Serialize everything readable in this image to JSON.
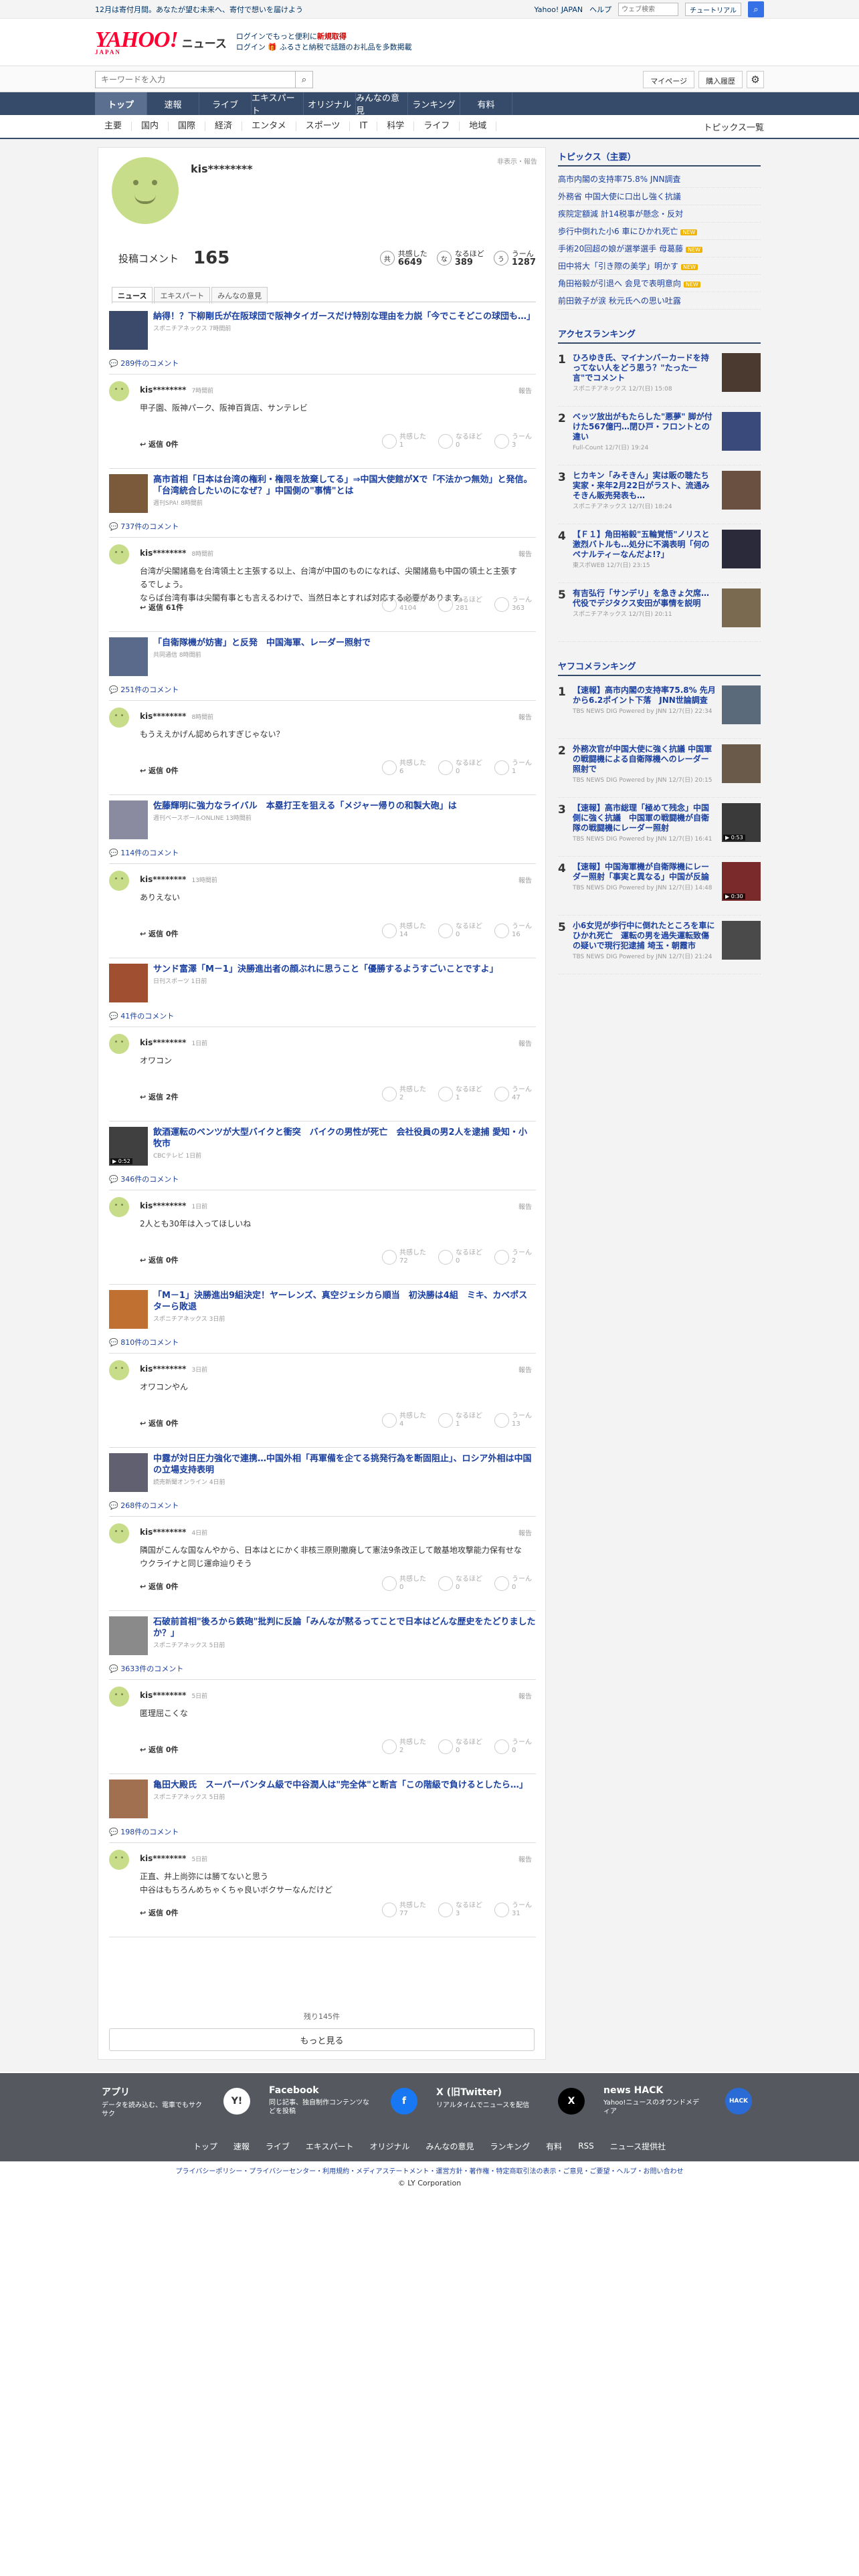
{
  "topbar": {
    "promo": "12月は寄付月間。あなたが望む未来へ、寄付で想いを届けよう",
    "links": [
      "Yahoo! JAPAN",
      "ヘルプ"
    ],
    "search_placeholder": "ウェブ検索",
    "tutorial": "チュートリアル"
  },
  "header": {
    "logo": "YAHOO!",
    "logo_sub": "JAPAN",
    "name": "ニュース",
    "promo1a": "ログインでもっと便利に",
    "promo1b": "新規取得",
    "promo2": "ログイン 🎁 ふるさと納税で話題のお礼品を多数掲載"
  },
  "search": {
    "placeholder": "キーワードを入力",
    "mypage": "マイページ",
    "history": "購入履歴"
  },
  "nav": [
    "トップ",
    "速報",
    "ライブ",
    "エキスパート",
    "オリジナル",
    "みんなの意見",
    "ランキング",
    "有料"
  ],
  "subnav": [
    "主要",
    "国内",
    "国際",
    "経済",
    "エンタメ",
    "スポーツ",
    "IT",
    "科学",
    "ライフ",
    "地域"
  ],
  "subnav_all": "トピックス一覧",
  "profile": {
    "name": "kis********",
    "hide": "非表示・報告",
    "post_label": "投稿コメント",
    "post_count": "165",
    "stats": [
      {
        "icon": "共",
        "label": "共感した",
        "value": "6649"
      },
      {
        "icon": "な",
        "label": "なるほど",
        "value": "389"
      },
      {
        "icon": "う",
        "label": "うーん",
        "value": "1287"
      }
    ]
  },
  "tabs": [
    "ニュース",
    "エキスパート",
    "みんなの意見"
  ],
  "entries": [
    {
      "title": "納得！？下柳剛氏が在阪球団で阪神タイガースだけ特別な理由を力説「今でこそどこの球団も…」",
      "src": "スポニチアネックス 7時間前",
      "comments": "289件のコメント",
      "time": "7時間前",
      "text": "甲子園、阪神パーク、阪神百貨店、サンテレビ",
      "reply": "返信 0件",
      "v": [
        "1",
        "0",
        "3"
      ]
    },
    {
      "title": "高市首相「日本は台湾の権利・権限を放棄してる」⇒中国大使館がXで「不法かつ無効」と発信。「台湾統合したいのになぜ？」中国側の\"事情\"とは",
      "src": "週刊SPA! 8時間前",
      "comments": "737件のコメント",
      "time": "8時間前",
      "text": "台湾が尖閣諸島を台湾領土と主張する以上、台湾が中国のものになれば、尖閣諸島も中国の領土と主張するでしょう。\nならば台湾有事は尖閣有事とも言えるわけで、当然日本とすれば対応する必要があります。",
      "reply": "返信 61件",
      "v": [
        "4104",
        "281",
        "363"
      ]
    },
    {
      "title": "「自衛隊機が妨害」と反発　中国海軍、レーダー照射で",
      "src": "共同通信 8時間前",
      "comments": "251件のコメント",
      "time": "8時間前",
      "text": "もうええかげん認められすぎじゃない？",
      "reply": "返信 0件",
      "v": [
        "6",
        "0",
        "1"
      ]
    },
    {
      "title": "佐藤輝明に強力なライバル　本塁打王を狙える「メジャー帰りの和製大砲」は",
      "src": "週刊ベースボールONLINE 13時間前",
      "comments": "114件のコメント",
      "time": "13時間前",
      "text": "ありえない",
      "reply": "返信 0件",
      "v": [
        "14",
        "0",
        "16"
      ]
    },
    {
      "title": "サンド富澤「M－1」決勝進出者の顔ぶれに思うこと「優勝するようすごいことですよ」",
      "src": "日刊スポーツ 1日前",
      "comments": "41件のコメント",
      "time": "1日前",
      "text": "オワコン",
      "reply": "返信 2件",
      "v": [
        "2",
        "1",
        "47"
      ]
    },
    {
      "title": "飲酒運転のベンツが大型バイクと衝突　バイクの男性が死亡　会社役員の男2人を逮捕 愛知・小牧市",
      "src": "CBCテレビ 1日前",
      "comments": "346件のコメント",
      "time": "1日前",
      "text": "2人とも30年は入ってほしいね",
      "reply": "返信 0件",
      "v": [
        "72",
        "0",
        "2"
      ]
    },
    {
      "title": "「M－1」決勝進出9組決定！ヤーレンズ、真空ジェシカら順当　初決勝は4組　ミキ、カベポスターら敗退",
      "src": "スポニチアネックス 3日前",
      "comments": "810件のコメント",
      "time": "3日前",
      "text": "オワコンやん",
      "reply": "返信 0件",
      "v": [
        "4",
        "1",
        "13"
      ]
    },
    {
      "title": "中露が対日圧力強化で連携…中国外相「再軍備を企てる挑発行為を断固阻止」、ロシア外相は中国の立場支持表明",
      "src": "読売新聞オンライン 4日前",
      "comments": "268件のコメント",
      "time": "4日前",
      "text": "隣国がこんな国なんやから、日本はとにかく非核三原則撤廃して憲法9条改正して敵基地攻撃能力保有せなウクライナと同じ運命辿りそう",
      "reply": "返信 0件",
      "v": [
        "0",
        "0",
        "0"
      ]
    },
    {
      "title": "石破前首相\"後ろから鉄砲\"批判に反論「みんなが黙るってことで日本はどんな歴史をたどりましたか？」",
      "src": "スポニチアネックス 5日前",
      "comments": "3633件のコメント",
      "time": "5日前",
      "text": "匿理屈こくな",
      "reply": "返信 0件",
      "v": [
        "2",
        "0",
        "0"
      ]
    },
    {
      "title": "亀田大殿氏　スーパーバンタム級で中谷潤人は\"完全体\"と断言「この階級で負けるとしたら…」",
      "src": "スポニチアネックス 5日前",
      "comments": "198件のコメント",
      "time": "5日前",
      "text": "正直、井上尚弥には勝てないと思う\n中谷はもちろんめちゃくちゃ良いボクサーなんだけど",
      "reply": "返信 0件",
      "v": [
        "77",
        "3",
        "31"
      ]
    }
  ],
  "vote_labels": [
    "共感した",
    "なるほど",
    "うーん"
  ],
  "report": "報告",
  "remaining": "残り145件",
  "more": "もっと見る",
  "topics": {
    "head": "トピックス（主要）",
    "items": [
      "高市内閣の支持率75.8% JNN調査",
      "外務省 中国大使に口出し強く抗議",
      "疾院定額減 計14税事が懸念・反対",
      "歩行中倒れた小6 車にひかれ死亡",
      "手術20回超の娘が選挙選手 母葛藤",
      "田中将大「引き際の美学」明かす",
      "角田裕毅が引退へ 会見で表明意向",
      "前田敦子が涙 秋元氏への思い吐露"
    ],
    "new": "NEW"
  },
  "access": {
    "head": "アクセスランキング",
    "items": [
      {
        "t": "ひろゆき氏、マイナンバーカードを持ってない人をどう思う？\"たった一言\"でコメント",
        "s": "スポニチアネックス 12/7(日) 15:08"
      },
      {
        "t": "ベッツ放出がもたらした\"悪夢\" 脚が付けた567億円…閉ひ戸・フロントとの違い",
        "s": "Full-Count 12/7(日) 19:24"
      },
      {
        "t": "ヒカキン「みそきん」実は販の聴たち実家・来年2月22日がラスト、流通みそきん販売発表も…",
        "s": "スポニチアネックス 12/7(日) 18:24"
      },
      {
        "t": "【Ｆ１】角田裕毅\"五輪覚悟\"ノリスと激烈バトルも…処分に不満表明「何のペナルティーなんだよ!?」",
        "s": "東スポWEB 12/7(日) 23:15"
      },
      {
        "t": "有吉弘行「サンデリ」を急きょ欠席…代役でデジタクス安田が事情を説明",
        "s": "スポニチアネックス 12/7(日) 20:11"
      }
    ]
  },
  "yafoo": {
    "head": "ヤフコメランキング",
    "items": [
      {
        "t": "【速報】高市内閣の支持率75.8% 先月から6.2ポイント下落　JNN世論調査",
        "s": "TBS NEWS DIG Powered by JNN 12/7(日) 22:34"
      },
      {
        "t": "外務次官が中国大使に強く抗議 中国軍の戦闘機による自衛隊機へのレーダー照射で",
        "s": "TBS NEWS DIG Powered by JNN 12/7(日) 20:15"
      },
      {
        "t": "【速報】高市総理「極めて残念」中国側に強く抗議　中国軍の戦闘機が自衛隊の戦闘機にレーダー照射",
        "s": "TBS NEWS DIG Powered by JNN 12/7(日) 16:41"
      },
      {
        "t": "【速報】中国海軍機が自衛隊機にレーダー照射「事実と異なる」中国が反論",
        "s": "TBS NEWS DIG Powered by JNN 12/7(日) 14:48"
      },
      {
        "t": "小6女児が歩行中に倒れたところを車にひかれ死亡　運転の男を過失運転致傷の疑いで現行犯逮捕 埼玉・朝霞市",
        "s": "TBS NEWS DIG Powered by JNN 12/7(日) 21:24"
      }
    ]
  },
  "vid_labels": [
    "▶ 0:53",
    "▶ 0:52",
    "▶ 0:30"
  ],
  "footer": {
    "apps": [
      {
        "t": "アプリ",
        "d": "データを読み込む、電車でもサクサク",
        "i": "Y!"
      },
      {
        "t": "Facebook",
        "d": "同じ記事、独自制作コンテンツなどを投稿",
        "i": "f"
      },
      {
        "t": "X (旧Twitter)",
        "d": "リアルタイムでニュースを配信",
        "i": "X"
      },
      {
        "t": "news HACK",
        "d": "Yahoo!ニュースのオウンドメディア",
        "i": "HACK"
      }
    ],
    "nav": [
      "トップ",
      "速報",
      "ライブ",
      "エキスパート",
      "オリジナル",
      "みんなの意見",
      "ランキング",
      "有料",
      "RSS",
      "ニュース提供社"
    ],
    "links": "プライバシーポリシー・プライバシーセンター・利用規約・メディアステートメント・運営方針・著作権・特定商取引法の表示・ご意見・ご要望・ヘルプ・お問い合わせ",
    "copy": "© LY Corporation"
  },
  "colors": {
    "nav": "#364b6a",
    "link": "#1a3f9e",
    "brand": "#ff0033"
  }
}
